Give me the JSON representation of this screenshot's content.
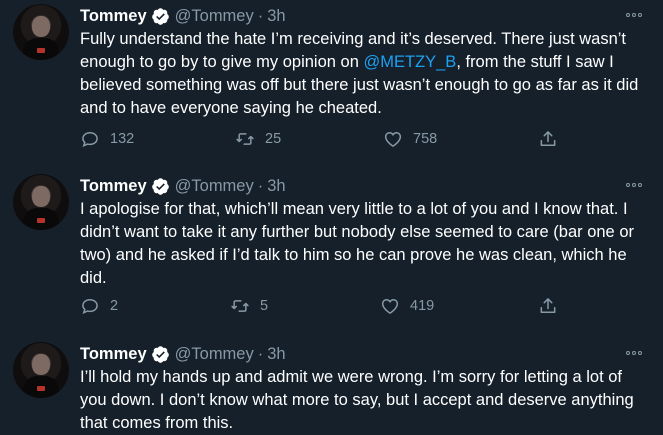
{
  "tweets": [
    {
      "name": "Tommey",
      "handle": "@Tommey",
      "separator": "·",
      "time": "3h",
      "text_before": "Fully understand the hate I’m receiving and it’s deserved. There just wasn’t enough to go by to give my opinion on ",
      "mention": "@METZY_B",
      "text_after": ", from the stuff I saw I believed something was off but there just wasn’t enough to go as far as it did and to have everyone saying he cheated.",
      "replies": "132",
      "retweets": "25",
      "likes": "758"
    },
    {
      "name": "Tommey",
      "handle": "@Tommey",
      "separator": "·",
      "time": "3h",
      "text": "I apologise for that, which’ll mean very little to a lot of you and I know that. I didn’t want to take it any further but nobody else seemed to care (bar one or two) and he asked if I’d talk to him so he can prove he was clean, which he did.",
      "replies": "2",
      "retweets": "5",
      "likes": "419"
    },
    {
      "name": "Tommey",
      "handle": "@Tommey",
      "separator": "·",
      "time": "3h",
      "text": "I’ll hold my hands up and admit we were wrong. I’m sorry for letting a lot of you down. I don’t know what more to say, but I accept and deserve anything that comes from this."
    }
  ],
  "colors": {
    "background": "#15202b",
    "text": "#ffffff",
    "muted": "#8899a6",
    "link": "#1da1f2"
  },
  "icons": [
    "verified-badge-icon",
    "more-options-icon",
    "reply-icon",
    "retweet-icon",
    "like-icon",
    "share-icon"
  ]
}
